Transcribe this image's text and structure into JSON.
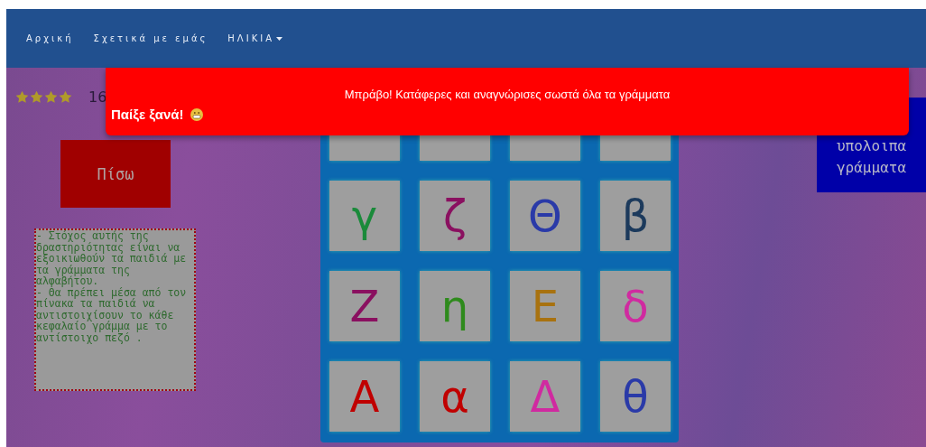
{
  "nav": {
    "items": [
      {
        "label": "Αρχική",
        "kind": "link"
      },
      {
        "label": "Σχετικά με εμάς",
        "kind": "link"
      },
      {
        "label": "ΗΛΙΚΙΑ",
        "kind": "dropdown"
      }
    ]
  },
  "score": {
    "stars": 4,
    "points": "16"
  },
  "back_button": "Πίσω",
  "description": "- Στόχος αυτής της δραστηριότητας είναι να εξοικιωθούν τα παιδιά με τα γράμματα της αλφαβήτου.\n- Θα πρέπει μέσα από τον πίνακα τα παιδιά να αντιστοιχίσουν το κάθε κεφαλαίο γράμμα με το αντίστοιχο πεζό .",
  "board": {
    "cells": [
      {
        "kind": "covered"
      },
      {
        "kind": "covered"
      },
      {
        "kind": "covered"
      },
      {
        "kind": "covered"
      },
      {
        "kind": "letter",
        "letter": "γ",
        "color": "#1a8a3a"
      },
      {
        "kind": "letter",
        "letter": "ζ",
        "color": "#8a1060"
      },
      {
        "kind": "letter",
        "letter": "Θ",
        "color": "#2a3aa8"
      },
      {
        "kind": "letter",
        "letter": "β",
        "color": "#1c3a5c"
      },
      {
        "kind": "letter",
        "letter": "Ζ",
        "color": "#8a1060"
      },
      {
        "kind": "letter",
        "letter": "η",
        "color": "#2e8a1c"
      },
      {
        "kind": "letter",
        "letter": "Ε",
        "color": "#a87210"
      },
      {
        "kind": "letter",
        "letter": "δ",
        "color": "#d02aa0"
      },
      {
        "kind": "letter",
        "letter": "Α",
        "color": "#c00000"
      },
      {
        "kind": "letter",
        "letter": "α",
        "color": "#c00000"
      },
      {
        "kind": "letter",
        "letter": "Δ",
        "color": "#d02aa0"
      },
      {
        "kind": "letter",
        "letter": "θ",
        "color": "#2a3aa8"
      }
    ]
  },
  "show_button": {
    "lines": [
      "υπολοιπα",
      "γράμματα"
    ]
  },
  "alert": {
    "message": "Μπράβο! Κατάφερες και αναγνώρισες σωστά όλα τα γράμματα",
    "action": "Παίξε ξανά!"
  }
}
